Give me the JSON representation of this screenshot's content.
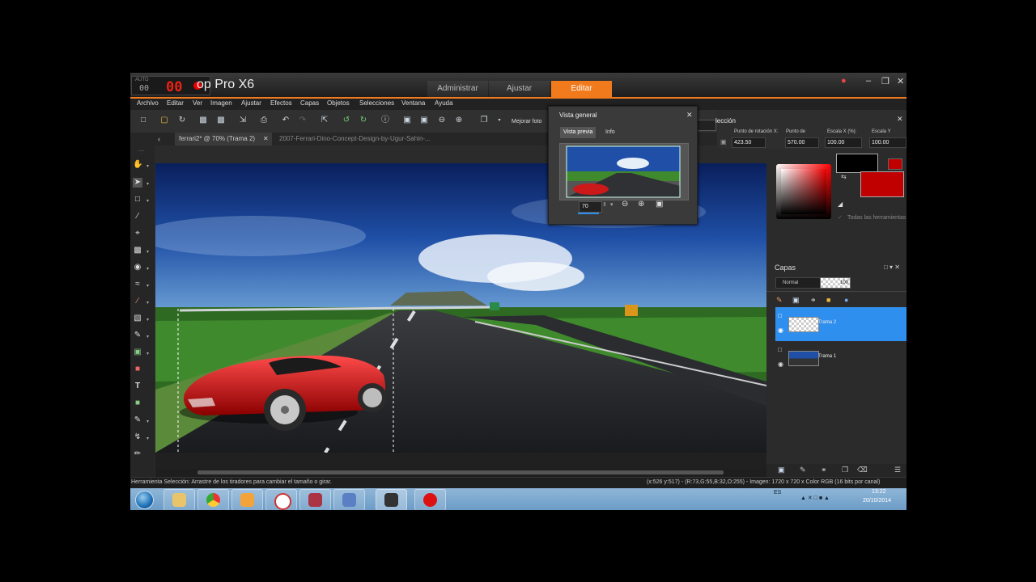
{
  "title": {
    "app": "op Pro X6",
    "rec_label": "AUTO",
    "rec_small": "00",
    "rec_big": "00"
  },
  "mode_tabs": [
    "Administrar",
    "Ajustar",
    "Editar"
  ],
  "menu": [
    "Archivo",
    "Editar",
    "Ver",
    "Imagen",
    "Ajustar",
    "Efectos",
    "Capas",
    "Objetos",
    "Selecciones",
    "Ventana",
    "Ayuda"
  ],
  "toolbar": {
    "enhance_label": "Mejorar foto"
  },
  "doc_tabs": {
    "active": "ferrari2* @  70% (Trama 2)",
    "inactive": "2007-Ferrari-Dino-Concept-Design-by-Ugur-Sahin-..."
  },
  "overview": {
    "title": "Vista general",
    "tabs": [
      "Vista previa",
      "Info"
    ],
    "zoom": "70"
  },
  "properties": {
    "title_fragment": "lección",
    "rot_x_label": "Punto de rotación X:",
    "rot_y_label": "Punto de",
    "scale_x_label": "Escala X (%):",
    "scale_y_label": "Escala Y",
    "rot_x": "423.50",
    "rot_y": "570.00",
    "scale_x": "100.00",
    "scale_y": "100.00"
  },
  "materials": {
    "all_tools_label": "Todas las herramientas"
  },
  "layers": {
    "title": "Capas",
    "blend_mode": "Normal",
    "opacity": "100",
    "items": [
      {
        "name": "Trama 2",
        "selected": true
      },
      {
        "name": "Trama 1",
        "selected": false
      }
    ]
  },
  "status": {
    "hint": "Herramienta Selección: Arrastre de los tiradores para cambiar el tamaño o girar.",
    "coords": "(x:526 y:517) - (R:73,G:55,B:32,O:255) - Imagen: 1720 x 720 x Color RGB (16 bits por canal)"
  },
  "taskbar": {
    "lang": "ES",
    "time": "13:22",
    "date": "20/10/2014"
  },
  "colors": {
    "accent": "#f07a1c",
    "selection": "#2f8fee",
    "foreground": "#c00000"
  }
}
